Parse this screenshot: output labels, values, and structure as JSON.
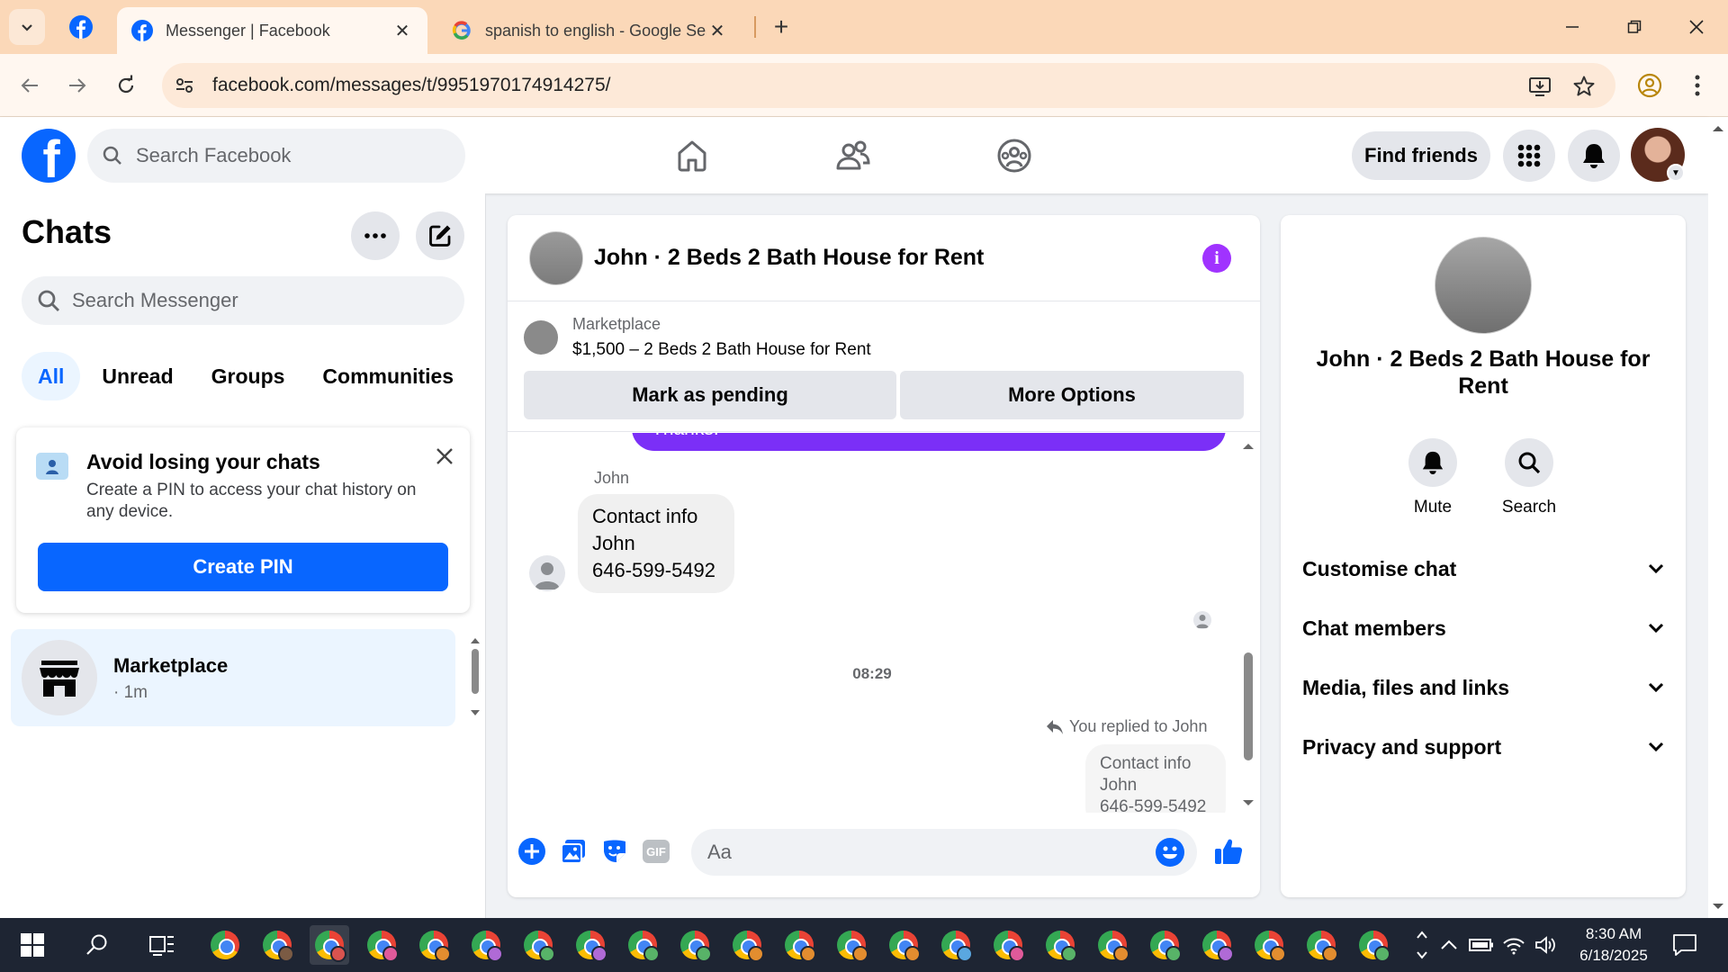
{
  "browser": {
    "active_tab_title": "Messenger | Facebook",
    "inactive_tab_title": "spanish to english - Google Sea",
    "url": "facebook.com/messages/t/9951970174914275/",
    "tab_bar_color": "#fbd8b8"
  },
  "fb_header": {
    "logo": "f",
    "search_placeholder": "Search Facebook",
    "find_friends_label": "Find friends",
    "brand_color": "#0866ff"
  },
  "sidebar": {
    "title": "Chats",
    "search_placeholder": "Search Messenger",
    "filters": [
      "All",
      "Unread",
      "Groups",
      "Communities"
    ],
    "active_filter": "All",
    "pin_card": {
      "title": "Avoid losing your chats",
      "description": "Create a PIN to access your chat history on any device.",
      "button_label": "Create PIN"
    },
    "chats": [
      {
        "name": "Marketplace",
        "meta": "· 1m"
      }
    ]
  },
  "conversation": {
    "title": "John · 2 Beds 2 Bath House for Rent",
    "marketplace_label": "Marketplace",
    "listing": "$1,500 – 2 Beds 2 Bath House for Rent",
    "mark_pending_label": "Mark as pending",
    "more_options_label": "More Options",
    "partial_outgoing_text": "Thanks!",
    "sender_name": "John",
    "incoming_message": [
      "Contact info",
      "John",
      "646-599-5492"
    ],
    "time_separator": "08:29",
    "replied_label": "You replied to John",
    "reply_quote": [
      "Contact info",
      "John",
      "646-599-5492"
    ],
    "composer_placeholder": "Aa",
    "gif_label": "GIF",
    "outgoing_bubble_color": "#7b2ff7"
  },
  "info_pane": {
    "title": "John · 2 Beds 2 Bath House for Rent",
    "mute_label": "Mute",
    "search_label": "Search",
    "sections": [
      "Customise chat",
      "Chat members",
      "Media, files and links",
      "Privacy and support"
    ]
  },
  "taskbar": {
    "time": "8:30 AM",
    "date": "6/18/2025"
  }
}
